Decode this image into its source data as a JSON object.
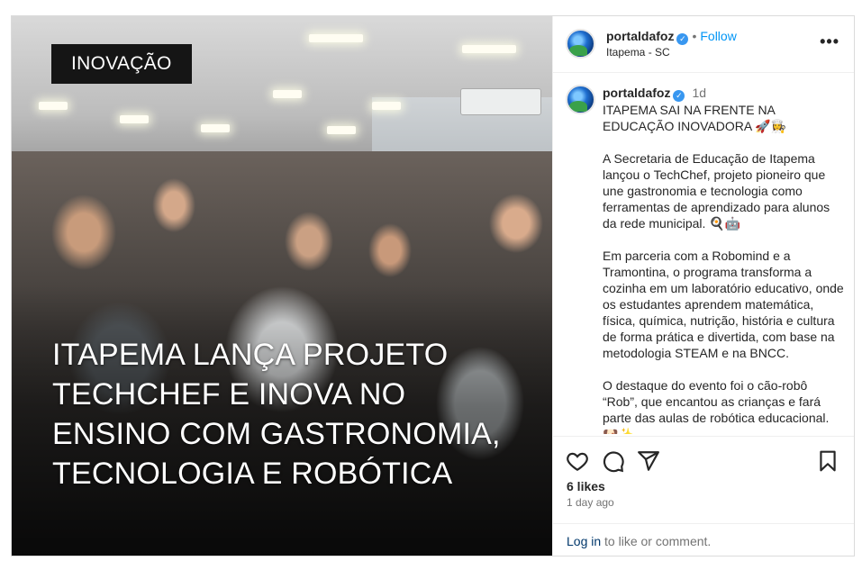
{
  "media": {
    "tag": "INOVAÇÃO",
    "headline": "ITAPEMA LANÇA PROJETO TECHCHEF E INOVA NO ENSINO COM GASTRONOMIA, TECNOLOGIA E ROBÓTICA"
  },
  "header": {
    "username": "portaldafoz",
    "separator": "•",
    "follow_label": "Follow",
    "location": "Itapema - SC",
    "more_icon": "more-horizontal-icon"
  },
  "post": {
    "username": "portaldafoz",
    "time": "1d",
    "caption": "ITAPEMA SAI NA FRENTE NA EDUCAÇÃO INOVADORA 🚀👩‍🍳\n\nA Secretaria de Educação de Itapema lançou o TechChef, projeto pioneiro que une gastronomia e tecnologia como ferramentas de aprendizado para alunos da rede municipal. 🍳🤖\n\nEm parceria com a Robomind e a Tramontina, o programa transforma a cozinha em um laboratório educativo, onde os estudantes aprendem matemática, física, química, nutrição, história e cultura de forma prática e divertida, com base na metodologia STEAM e na BNCC.\n\nO destaque do evento foi o cão-robô “Rob”, que encantou as crianças e fará parte das aulas de robótica educacional. 🐶✨"
  },
  "actions": {
    "likes": "6 likes",
    "date": "1 day ago",
    "login_link": "Log in",
    "login_rest": " to like or comment."
  },
  "colors": {
    "link_blue": "#0095f6",
    "verified_blue": "#3897f0",
    "muted": "#737373"
  }
}
